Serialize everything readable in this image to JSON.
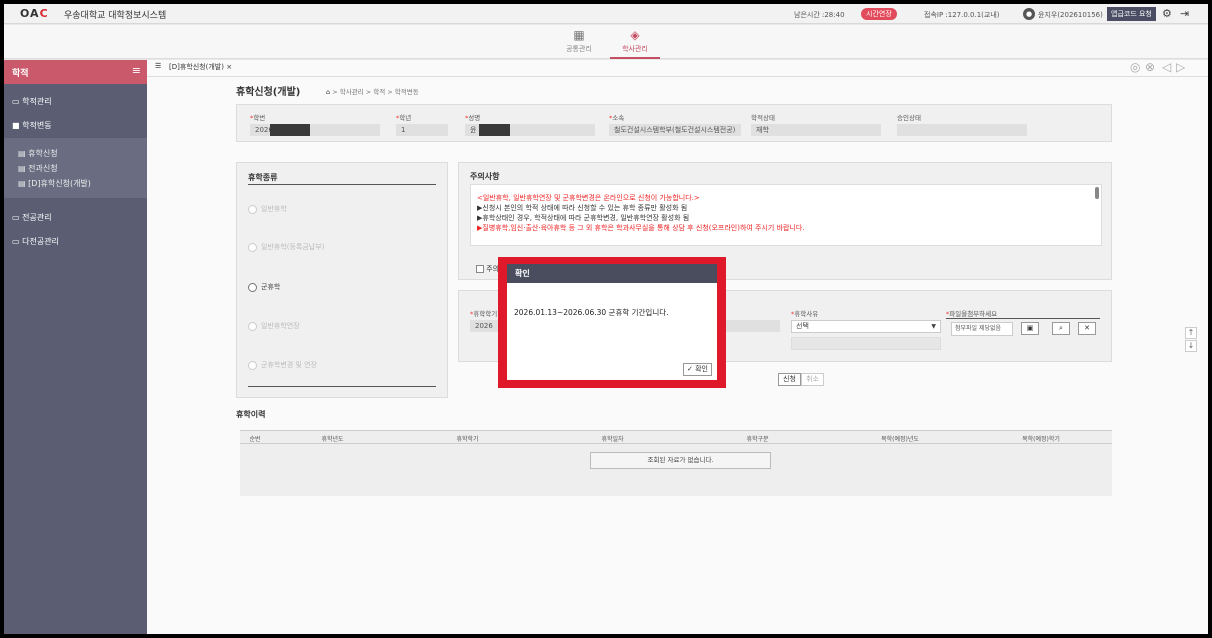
{
  "header": {
    "logo_prefix": "OA",
    "logo_accent": "C",
    "system_name": "우송대학교 대학정보시스템",
    "remaining_time": "남은시간 :28:40",
    "extend_button": "시간연장",
    "access_ip": "접속IP :127.0.0.1(교내)",
    "user_name": "윤지우(202610156)",
    "auth_code_button": "앱급코드 요청",
    "settings_icon": "gear-icon",
    "logout_icon": "logout-icon"
  },
  "menu": {
    "items": [
      {
        "label": "공통관리",
        "icon": "grid-icon"
      },
      {
        "label": "학사관리",
        "icon": "graduation-cap-icon"
      }
    ]
  },
  "sidebar": {
    "title": "학적",
    "items": [
      {
        "label": "학적관리"
      },
      {
        "label": "학적변동"
      },
      {
        "label": "전공관리"
      },
      {
        "label": "다전공관리"
      }
    ],
    "sub_items": [
      {
        "label": "휴학신청"
      },
      {
        "label": "전과신청"
      },
      {
        "label": "[D]휴학신청(개발)"
      }
    ]
  },
  "tabs": {
    "active": "[D]휴학신청(개발)",
    "close": "×"
  },
  "page": {
    "title": "휴학신청(개발)",
    "breadcrumb": "학사관리 > 학적 > 학적변동"
  },
  "student": {
    "student_id_label": "학번",
    "student_id": "2026",
    "grade_label": "학년",
    "grade": "1",
    "name_label": "성명",
    "name": "윤",
    "dept_label": "소속",
    "dept": "철도건설시스템학부(철도건설시스템전공)",
    "status_label": "학적상태",
    "status": "재학",
    "approval_label": "승인상태",
    "approval": ""
  },
  "leave_types": {
    "title": "휴학종류",
    "options": [
      "일반휴학",
      "일반휴학(등록금납부)",
      "군휴학",
      "일반휴학연장",
      "군휴학변경 및 연장"
    ]
  },
  "notice": {
    "title": "주의사항",
    "line1": "<일반휴학, 일반휴학연장 및 군휴학변경은 온라인으로 신청이 가능합니다.>",
    "line2": "▶신청시 본인의 학적 상태에 따라 신청할 수 있는 휴학 종류만 활성화 됨",
    "line3": "▶휴학상태인 경우, 학적상태에 따라 군휴학변경, 일반휴학연장 활성화 됨",
    "line4": "▶질병휴학,임신·출산·육아휴학 등 그 외 휴학은 학과사무실을 통해 상담 후 신청(오프라인)하여 주시기 바랍니다.",
    "confirm_check": "주의"
  },
  "form": {
    "leave_year_label": "휴학학기",
    "leave_year": "2026",
    "reason_label": "휴학사유",
    "reason_value": "선택",
    "attach_label": "파일을첨부하세요",
    "attach_value": "첨부파일 제당없음",
    "apply_button": "신청",
    "cancel_button": "취소"
  },
  "history": {
    "title": "휴학이력",
    "columns": [
      "순번",
      "휴학년도",
      "휴학학기",
      "휴학일자",
      "휴학구분",
      "복학(예정)년도",
      "복학(예정)학기"
    ],
    "empty_message": "조회된 자료가 없습니다."
  },
  "dialog": {
    "title": "확인",
    "message": "2026.01.13~2026.06.30 군휴학 기간입니다.",
    "ok_button": "✓ 확인"
  },
  "colors": {
    "accent": "#c9596b",
    "sidebar": "#5b5e73",
    "dialog_highlight": "#e0192a",
    "notice_red": "#e22222"
  }
}
